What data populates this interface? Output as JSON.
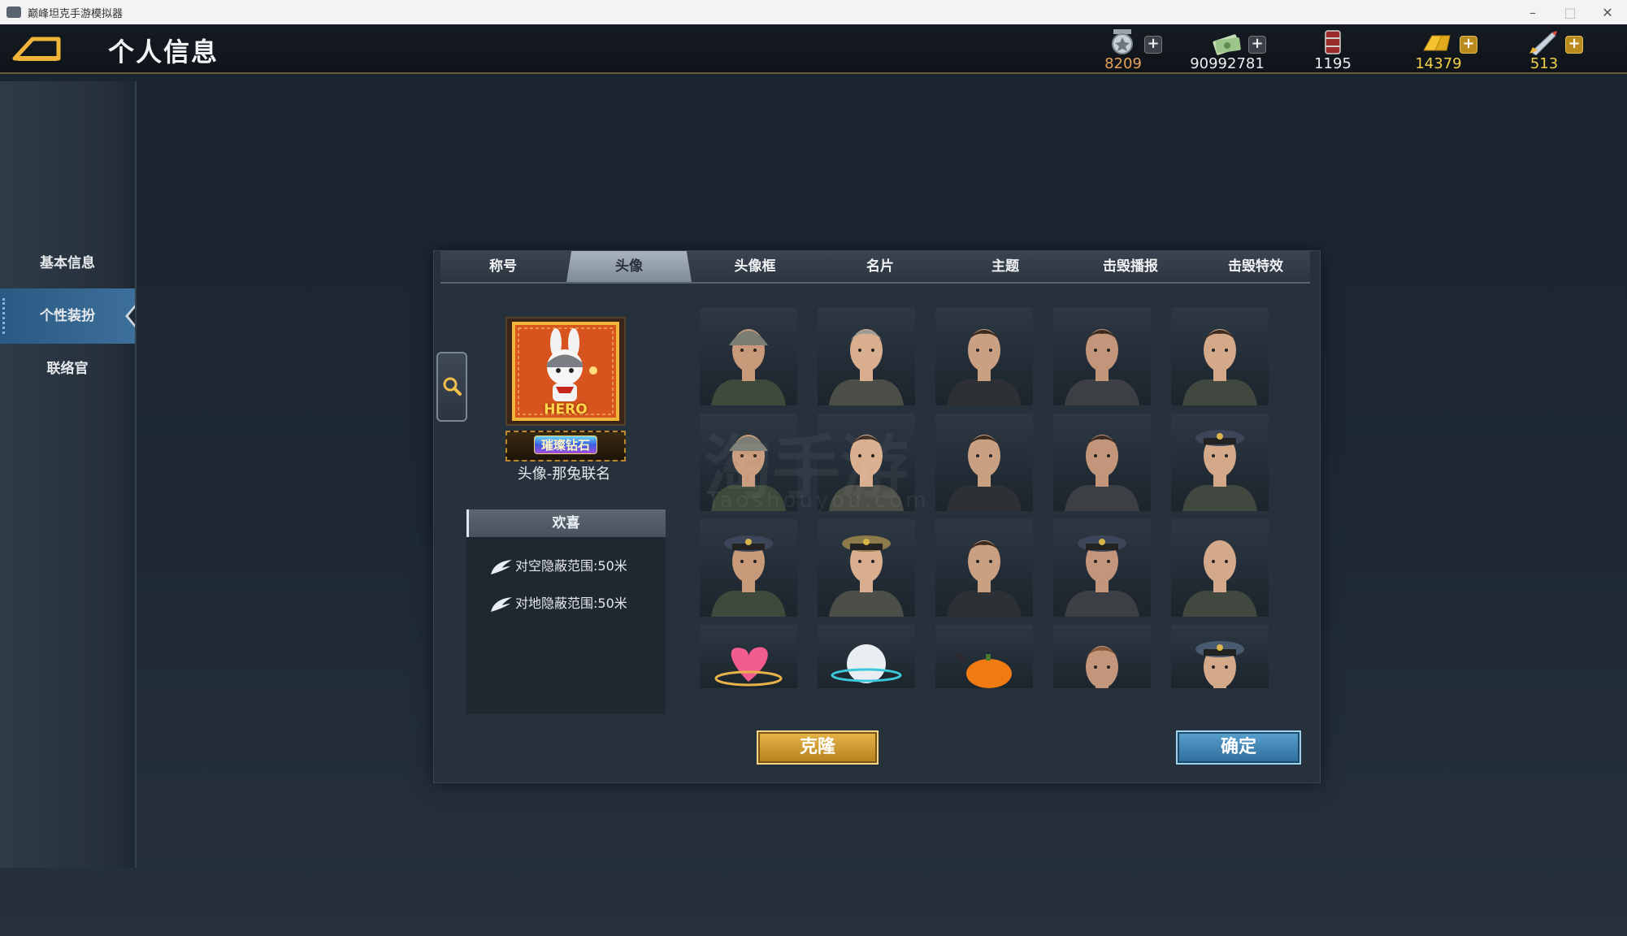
{
  "window": {
    "title": "巅峰坦克手游模拟器",
    "minimize": "–",
    "maximize": "□",
    "close": "✕"
  },
  "header": {
    "title": "个人信息"
  },
  "resources": [
    {
      "icon": "medal-icon",
      "value": "8209",
      "color": "#e8a15a",
      "has_plus": true,
      "plus_style": "gray"
    },
    {
      "icon": "cash-icon",
      "value": "90992781",
      "color": "#ffffff",
      "has_plus": true,
      "plus_style": "gray"
    },
    {
      "icon": "fuel-barrel-icon",
      "value": "1195",
      "color": "#ffffff",
      "has_plus": false
    },
    {
      "icon": "gold-bar-icon",
      "value": "14379",
      "color": "#f3d04a",
      "has_plus": true,
      "plus_style": "gold"
    },
    {
      "icon": "rocket-icon",
      "value": "513",
      "color": "#f3d04a",
      "has_plus": true,
      "plus_style": "gold"
    }
  ],
  "sidebar": {
    "items": [
      {
        "label": "基本信息",
        "active": false
      },
      {
        "label": "个性装扮",
        "active": true
      },
      {
        "label": "联络官",
        "active": false
      }
    ]
  },
  "tabs": [
    {
      "label": "称号",
      "active": false
    },
    {
      "label": "头像",
      "active": true
    },
    {
      "label": "头像框",
      "active": false
    },
    {
      "label": "名片",
      "active": false
    },
    {
      "label": "主题",
      "active": false
    },
    {
      "label": "击毁播报",
      "active": false
    },
    {
      "label": "击毁特效",
      "active": false
    }
  ],
  "preview": {
    "avatar_label": "HERO",
    "badge": "璀璨钻石",
    "name": "头像-那兔联名"
  },
  "description": {
    "header": "欢喜",
    "attributes": [
      "对空隐蔽范围:50米",
      "对地隐蔽范围:50米"
    ]
  },
  "avatars": [
    "soldier-helmet",
    "officer-gray-hair",
    "woman-ponytail",
    "young-officer",
    "officer-smiling",
    "soldier-helmet-2",
    "officer-scarf",
    "young-soldier",
    "young-soldier-2",
    "officer-peaked-cap",
    "general-peaked-cap",
    "general-gold-cap",
    "officer-suit",
    "soldier-side-cap",
    "general-bald",
    "heart-item",
    "globe-item",
    "pumpkin-item",
    "woman-curly-hair",
    "officer-blue-cap"
  ],
  "watermark": {
    "text": "淘手游",
    "sub": "Taoshouyou.com"
  },
  "buttons": {
    "clone": "克隆",
    "confirm": "确定"
  }
}
